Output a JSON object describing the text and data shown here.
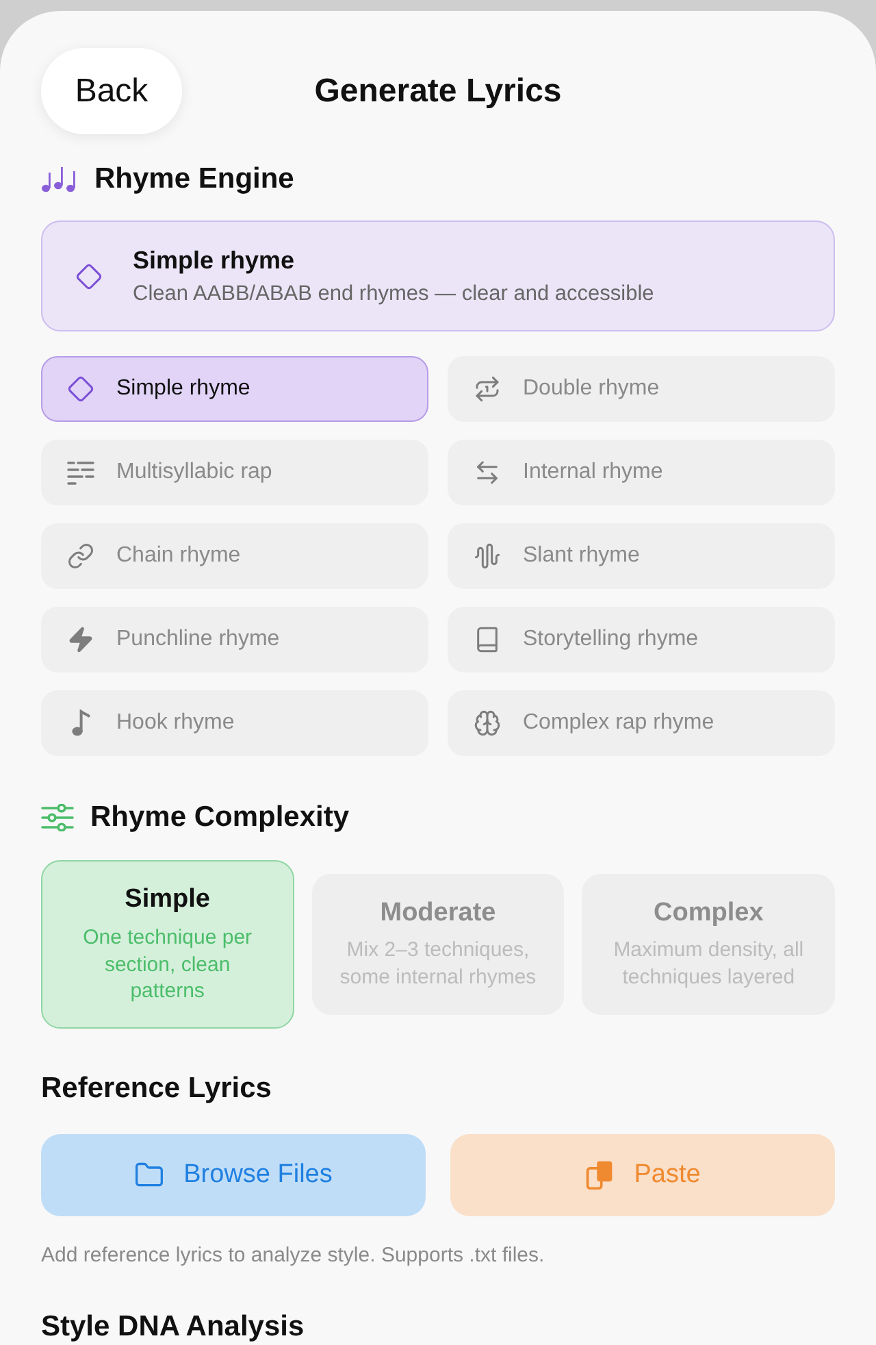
{
  "header": {
    "back_button": "Back",
    "title": "Generate Lyrics"
  },
  "rhyme_engine": {
    "heading": "Rhyme Engine",
    "current": {
      "title": "Simple rhyme",
      "description": "Clean AABB/ABAB end rhymes — clear and accessible"
    },
    "options": [
      {
        "label": "Simple rhyme",
        "selected": true
      },
      {
        "label": "Double rhyme",
        "selected": false
      },
      {
        "label": "Multisyllabic rap",
        "selected": false
      },
      {
        "label": "Internal rhyme",
        "selected": false
      },
      {
        "label": "Chain rhyme",
        "selected": false
      },
      {
        "label": "Slant rhyme",
        "selected": false
      },
      {
        "label": "Punchline rhyme",
        "selected": false
      },
      {
        "label": "Storytelling rhyme",
        "selected": false
      },
      {
        "label": "Hook rhyme",
        "selected": false
      },
      {
        "label": "Complex rap rhyme",
        "selected": false
      }
    ]
  },
  "rhyme_complexity": {
    "heading": "Rhyme Complexity",
    "levels": [
      {
        "title": "Simple",
        "description": "One technique per section, clean patterns",
        "selected": true
      },
      {
        "title": "Moderate",
        "description": "Mix 2–3 techniques, some internal rhymes",
        "selected": false
      },
      {
        "title": "Complex",
        "description": "Maximum density, all techniques layered",
        "selected": false
      }
    ]
  },
  "reference_lyrics": {
    "heading": "Reference Lyrics",
    "buttons": [
      {
        "label": "Browse Files",
        "kind": "browse"
      },
      {
        "label": "Paste",
        "kind": "paste"
      }
    ],
    "hint": "Add reference lyrics to analyze style. Supports .txt files."
  },
  "next_section": {
    "heading": "Style DNA Analysis"
  }
}
